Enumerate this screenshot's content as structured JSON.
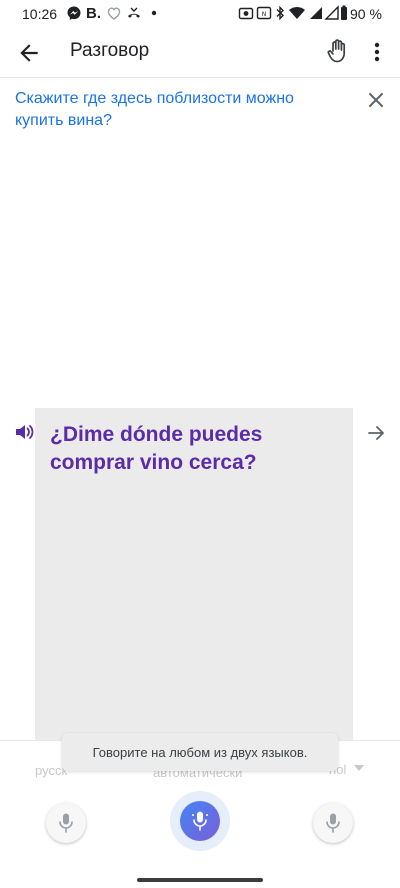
{
  "status_bar": {
    "time": "10:26",
    "carrier_letter": "B.",
    "battery_percent": "90 %"
  },
  "app_bar": {
    "title": "Разговор"
  },
  "conversation": {
    "source_text": "Скажите где здесь поблизости можно купить вина?",
    "translated_text": "¿Dime dónde puedes comprar vino cerca?"
  },
  "language_bar": {
    "left_language": "русск",
    "center_label": "автоматически",
    "right_language": "ñol"
  },
  "toast": {
    "message": "Говорите на любом из двух языков."
  },
  "colors": {
    "source_text": "#1a73e8",
    "translated_text": "#5b2ba8",
    "mic_gradient_start": "#4285f4",
    "mic_gradient_end": "#7b5fd9"
  },
  "icons": {
    "back": "arrow-back-icon",
    "hand": "hand-icon",
    "more": "more-vert-icon",
    "clear": "close-icon",
    "speaker": "speaker-icon",
    "forward": "arrow-forward-icon",
    "mic": "mic-icon"
  }
}
